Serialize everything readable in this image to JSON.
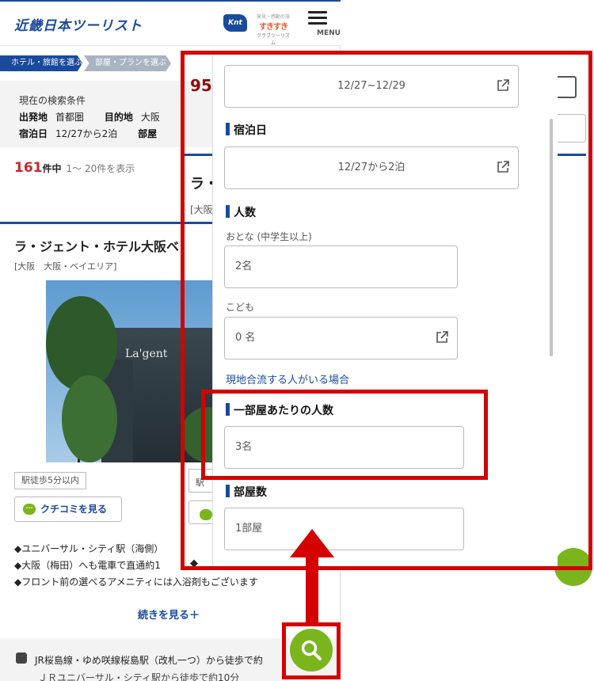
{
  "header": {
    "logo": "近畿日本ツーリスト",
    "knt": "Knt",
    "sub_logo": {
      "line1": "発見・感動の旅",
      "line2": "すきすき",
      "line3": "クラブツーリズム"
    },
    "menu_label": "MENU"
  },
  "breadcrumbs": [
    "ホテル・旅館を選ぶ",
    "部屋・プランを選ぶ"
  ],
  "search_conditions": {
    "title": "現在の検索条件",
    "departure_label": "出発地",
    "departure": "首都圏",
    "destination_label": "目的地",
    "destination": "大阪",
    "stay_label": "宿泊日",
    "stay": "12/27から2泊",
    "room_label": "部屋"
  },
  "results": {
    "count": "161",
    "unit": "件中",
    "range": "1〜 20件を表示"
  },
  "hotel": {
    "name": "ラ・ジェント・ホテル大阪ベ",
    "area": "[大阪　大阪・ベイエリア]",
    "photo_sign": "La'gent",
    "walk_tag": "駅徒歩5分以内",
    "review_button": "クチコミを見る",
    "review_icon_text": "···",
    "features": [
      "◆ユニバーサル・シティ駅（海側）",
      "◆大阪（梅田）へも電車で直通約1",
      "◆フロント前の選べるアメニティには入浴剤もございます"
    ],
    "more": "続きを見る＋",
    "access1": "JR桜島線・ゆめ咲線桜島駅（改札一つ）から徒歩で約",
    "access2": "ＪＲユニバーサル・シティ駅から徒歩で約10分"
  },
  "background_right": {
    "price_fragment": "95",
    "name_fragment": "ラ・",
    "area_fragment": "[大阪",
    "walk_fragment": "駅",
    "name_fragment2": "ラ・",
    "feature_fragment": "◆"
  },
  "modal": {
    "dates_value": "12/27~12/29",
    "stay_heading": "宿泊日",
    "stay_value": "12/27から2泊",
    "people_heading": "人数",
    "adult_label": "おとな (中学生以上)",
    "adult_value": "2名",
    "child_label": "こども",
    "child_value": "0 名",
    "join_link": "現地合流する人がいる場合",
    "per_room_heading": "一部屋あたりの人数",
    "per_room_value": "3名",
    "rooms_heading": "部屋数",
    "rooms_value": "1部屋"
  },
  "colors": {
    "brand_blue": "#1a4a9c",
    "annotation_red": "#d50000",
    "search_green": "#7ab51d"
  }
}
